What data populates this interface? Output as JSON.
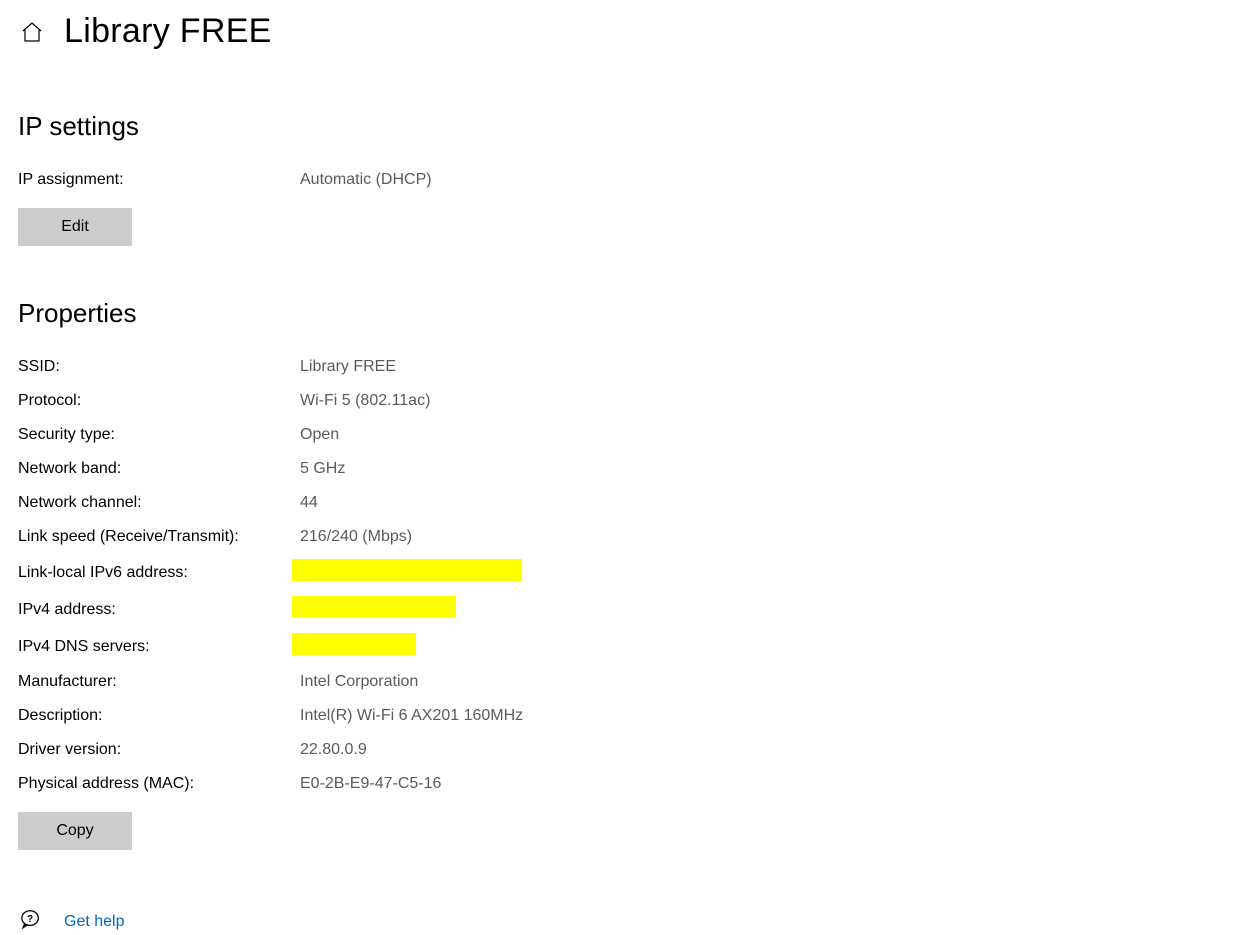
{
  "header": {
    "title": "Library FREE"
  },
  "ip_settings": {
    "heading": "IP settings",
    "assignment_label": "IP assignment:",
    "assignment_value": "Automatic (DHCP)",
    "edit_button": "Edit"
  },
  "properties": {
    "heading": "Properties",
    "rows": [
      {
        "label": "SSID:",
        "value": "Library FREE"
      },
      {
        "label": "Protocol:",
        "value": "Wi-Fi 5 (802.11ac)"
      },
      {
        "label": "Security type:",
        "value": "Open"
      },
      {
        "label": "Network band:",
        "value": "5 GHz"
      },
      {
        "label": "Network channel:",
        "value": "44"
      },
      {
        "label": "Link speed (Receive/Transmit):",
        "value": "216/240 (Mbps)"
      },
      {
        "label": "Link-local IPv6 address:",
        "value": "",
        "redacted": "w1"
      },
      {
        "label": "IPv4 address:",
        "value": "",
        "redacted": "w2"
      },
      {
        "label": "IPv4 DNS servers:",
        "value": "",
        "redacted": "w3"
      },
      {
        "label": "Manufacturer:",
        "value": "Intel Corporation"
      },
      {
        "label": "Description:",
        "value": "Intel(R) Wi-Fi 6 AX201 160MHz"
      },
      {
        "label": "Driver version:",
        "value": "22.80.0.9"
      },
      {
        "label": "Physical address (MAC):",
        "value": "E0-2B-E9-47-C5-16"
      }
    ],
    "copy_button": "Copy"
  },
  "help": {
    "link_text": "Get help"
  }
}
